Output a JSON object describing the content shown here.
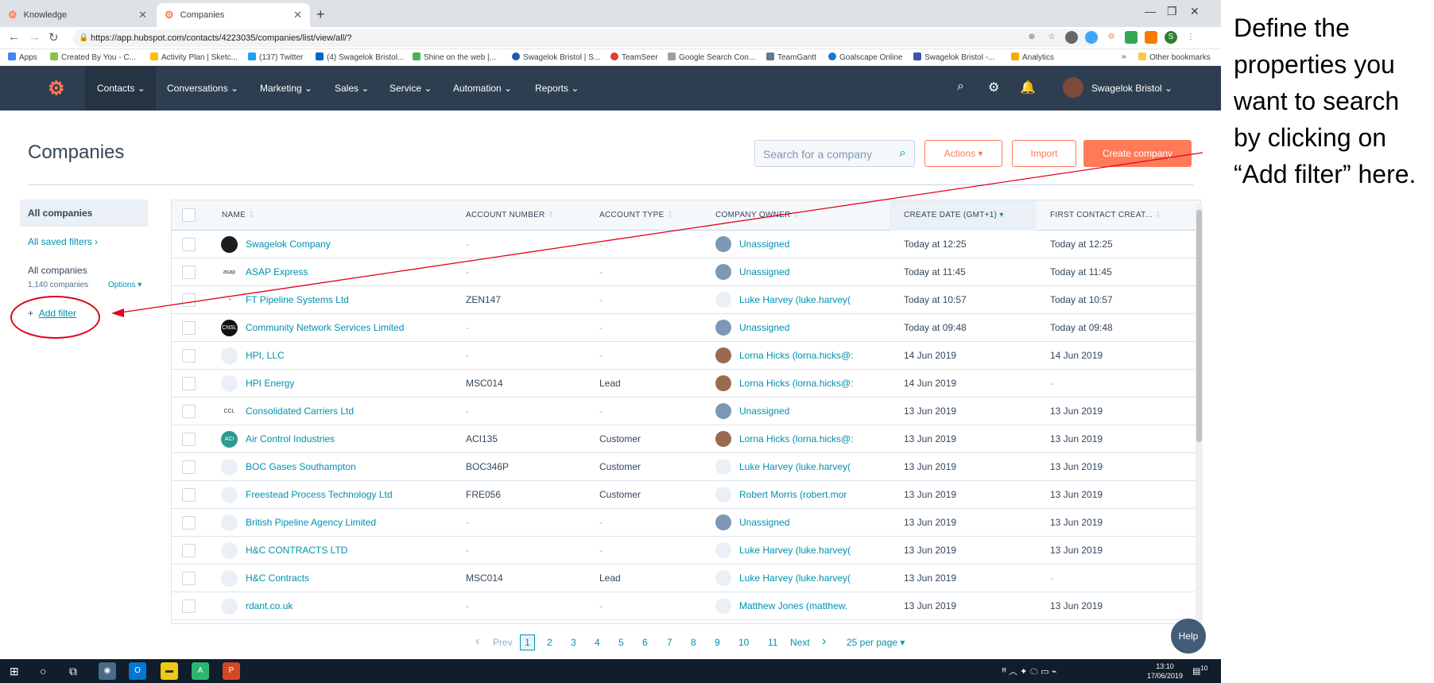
{
  "browser": {
    "tabs": [
      {
        "label": "Knowledge",
        "active": false
      },
      {
        "label": "Companies",
        "active": true
      }
    ],
    "url": "https://app.hubspot.com/contacts/4223035/companies/list/view/all/?",
    "bookmarks": [
      {
        "label": "Apps",
        "color": "#4285f4"
      },
      {
        "label": "Created By You - C...",
        "color": "#8bc34a"
      },
      {
        "label": "Activity Plan | Sketc...",
        "color": "#fbbc05"
      },
      {
        "label": "(137) Twitter",
        "color": "#1da1f2"
      },
      {
        "label": "(4) Swagelok Bristol...",
        "color": "#0a66c2"
      },
      {
        "label": "Shine on the web |...",
        "color": "#4caf50"
      },
      {
        "label": "Swagelok Bristol | S...",
        "color": "#1e5aa8"
      },
      {
        "label": "TeamSeer",
        "color": "#e53935"
      },
      {
        "label": "Google Search Con...",
        "color": "#9e9e9e"
      },
      {
        "label": "TeamGantt",
        "color": "#607d8b"
      },
      {
        "label": "Goalscape Online",
        "color": "#1976d2"
      },
      {
        "label": "Swagelok Bristol -...",
        "color": "#3f51b5"
      },
      {
        "label": "Analytics",
        "color": "#f9ab00"
      }
    ],
    "bookmarks_more": "»",
    "other_bookmarks": "Other bookmarks"
  },
  "hubspot_nav": {
    "menus": [
      "Contacts",
      "Conversations",
      "Marketing",
      "Sales",
      "Service",
      "Automation",
      "Reports"
    ],
    "active_menu": "Contacts",
    "account": "Swagelok Bristol"
  },
  "page": {
    "title": "Companies",
    "search_placeholder": "Search for a company",
    "actions_label": "Actions",
    "import_label": "Import",
    "create_label": "Create company"
  },
  "sidebar": {
    "all_companies_tab": "All companies",
    "saved_filters": "All saved filters",
    "view_name": "All companies",
    "count": "1,140 companies",
    "options": "Options",
    "add_filter": "Add filter"
  },
  "table": {
    "columns": [
      "NAME",
      "ACCOUNT NUMBER",
      "ACCOUNT TYPE",
      "COMPANY OWNER",
      "CREATE DATE (GMT+1)",
      "FIRST CONTACT CREAT..."
    ],
    "rows": [
      {
        "name": "Swagelok Company",
        "acct": "-",
        "type": "-",
        "owner": "Unassigned",
        "owner_kind": "unassigned",
        "logo": "dark",
        "created": "Today at 12:25",
        "first": "Today at 12:25"
      },
      {
        "name": "ASAP Express",
        "acct": "-",
        "type": "-",
        "owner": "Unassigned",
        "owner_kind": "unassigned",
        "logo": "asap",
        "created": "Today at 11:45",
        "first": "Today at 11:45"
      },
      {
        "name": "FT Pipeline Systems Ltd",
        "acct": "ZEN147",
        "type": "-",
        "owner": "Luke Harvey (luke.harvey(",
        "owner_kind": "person",
        "logo": "ft",
        "created": "Today at 10:57",
        "first": "Today at 10:57"
      },
      {
        "name": "Community Network Services Limited",
        "acct": "-",
        "type": "-",
        "owner": "Unassigned",
        "owner_kind": "unassigned",
        "logo": "cnsl",
        "created": "Today at 09:48",
        "first": "Today at 09:48"
      },
      {
        "name": "HPI, LLC",
        "acct": "-",
        "type": "-",
        "owner": "Lorna Hicks (lorna.hicks@:",
        "owner_kind": "photo",
        "logo": "none",
        "created": "14 Jun 2019",
        "first": "14 Jun 2019"
      },
      {
        "name": "HPI Energy",
        "acct": "MSC014",
        "type": "Lead",
        "owner": "Lorna Hicks (lorna.hicks@:",
        "owner_kind": "photo",
        "logo": "none",
        "created": "14 Jun 2019",
        "first": "-"
      },
      {
        "name": "Consolidated Carriers Ltd",
        "acct": "-",
        "type": "-",
        "owner": "Unassigned",
        "owner_kind": "unassigned",
        "logo": "ccl",
        "created": "13 Jun 2019",
        "first": "13 Jun 2019"
      },
      {
        "name": "Air Control Industries",
        "acct": "ACI135",
        "type": "Customer",
        "owner": "Lorna Hicks (lorna.hicks@:",
        "owner_kind": "photo",
        "logo": "aci",
        "created": "13 Jun 2019",
        "first": "13 Jun 2019"
      },
      {
        "name": "BOC Gases Southampton",
        "acct": "BOC346P",
        "type": "Customer",
        "owner": "Luke Harvey (luke.harvey(",
        "owner_kind": "person",
        "logo": "none",
        "created": "13 Jun 2019",
        "first": "13 Jun 2019"
      },
      {
        "name": "Freestead Process Technology Ltd",
        "acct": "FRE056",
        "type": "Customer",
        "owner": "Robert Morris (robert.mor",
        "owner_kind": "person",
        "logo": "none",
        "created": "13 Jun 2019",
        "first": "13 Jun 2019"
      },
      {
        "name": "British Pipeline Agency Limited",
        "acct": "-",
        "type": "-",
        "owner": "Unassigned",
        "owner_kind": "unassigned",
        "logo": "none",
        "created": "13 Jun 2019",
        "first": "13 Jun 2019"
      },
      {
        "name": "H&C CONTRACTS LTD",
        "acct": "-",
        "type": "-",
        "owner": "Luke Harvey (luke.harvey(",
        "owner_kind": "person",
        "logo": "none",
        "created": "13 Jun 2019",
        "first": "13 Jun 2019"
      },
      {
        "name": "H&C Contracts",
        "acct": "MSC014",
        "type": "Lead",
        "owner": "Luke Harvey (luke.harvey(",
        "owner_kind": "person",
        "logo": "none",
        "created": "13 Jun 2019",
        "first": "-"
      },
      {
        "name": "rdant.co.uk",
        "acct": "-",
        "type": "-",
        "owner": "Matthew Jones (matthew.",
        "owner_kind": "person",
        "logo": "none",
        "created": "13 Jun 2019",
        "first": "13 Jun 2019"
      }
    ]
  },
  "pagination": {
    "prev": "Prev",
    "pages": [
      "1",
      "2",
      "3",
      "4",
      "5",
      "6",
      "7",
      "8",
      "9",
      "10",
      "11"
    ],
    "current": "1",
    "next": "Next",
    "per_page": "25 per page"
  },
  "help_label": "Help",
  "taskbar": {
    "time": "13:10",
    "date": "17/06/2019",
    "notifications": "10"
  },
  "annotation": "Define the properties you want to search by clicking on “Add filter” here.",
  "colors": {
    "brand": "#ff7a59",
    "nav_bg": "#2d3e50",
    "link": "#0091ae",
    "annotation_red": "#e3001b"
  }
}
